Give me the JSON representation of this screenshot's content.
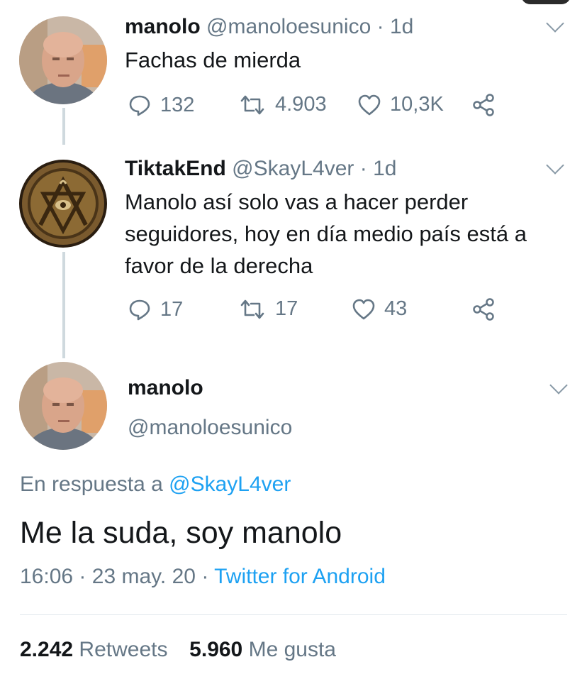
{
  "tweets": [
    {
      "name": "manolo",
      "handle": "@manoloesunico",
      "sep": "·",
      "time": "1d",
      "text": "Fachas de mierda",
      "replies": "132",
      "retweets": "4.903",
      "likes": "10,3K"
    },
    {
      "name": "TiktakEnd",
      "handle": "@SkayL4ver",
      "sep": "·",
      "time": "1d",
      "text_lines": [
        "Manolo así solo vas a hacer perder",
        "seguidores, hoy en día medio país está a",
        "favor de la derecha"
      ],
      "replies": "17",
      "retweets": "17",
      "likes": "43"
    }
  ],
  "main": {
    "name": "manolo",
    "handle": "@manoloesunico",
    "reply_prefix": "En respuesta a",
    "reply_to": "@SkayL4ver",
    "text": "Me la suda, soy manolo",
    "time": "16:06",
    "sep": "·",
    "date": "23 may. 20",
    "source": "Twitter for Android",
    "retweets_count": "2.242",
    "retweets_label": "Retweets",
    "likes_count": "5.960",
    "likes_label": "Me gusta"
  },
  "icons": [
    "reply-icon",
    "retweet-icon",
    "like-icon",
    "share-icon",
    "chevron-down-icon"
  ],
  "colors": {
    "link": "#1da1f2",
    "muted": "#657786",
    "text": "#14171a"
  }
}
